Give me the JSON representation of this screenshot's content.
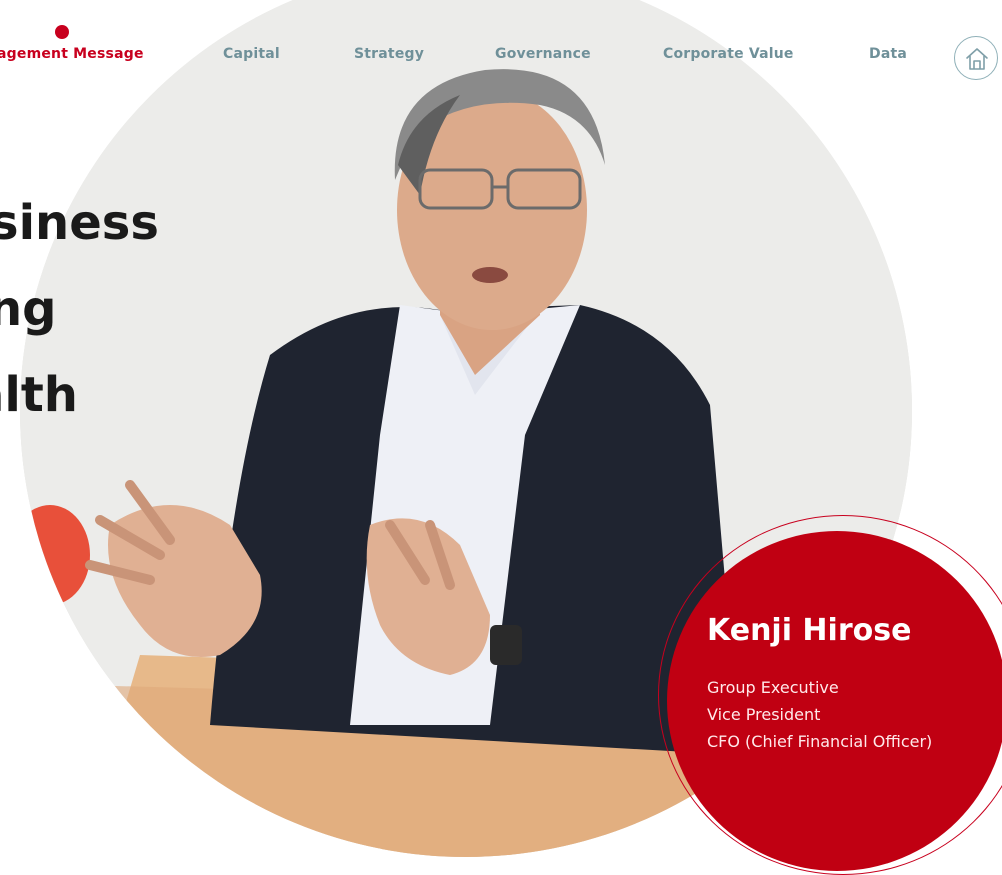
{
  "nav": {
    "items": [
      {
        "label": "agement Message",
        "active": true
      },
      {
        "label": "Capital",
        "active": false
      },
      {
        "label": "Strategy",
        "active": false
      },
      {
        "label": "Governance",
        "active": false
      },
      {
        "label": "Corporate Value",
        "active": false
      },
      {
        "label": "Data",
        "active": false
      }
    ],
    "home_icon": "home-icon"
  },
  "headline": {
    "line1": "siness",
    "line2": "ng",
    "line3": "alth"
  },
  "profile": {
    "name": "Kenji Hirose",
    "roles": [
      "Group Executive",
      "Vice President",
      "CFO (Chief Financial Officer)"
    ]
  },
  "colors": {
    "accent": "#c8001e",
    "nav": "#6f9099",
    "heading": "#1a1a1a"
  }
}
